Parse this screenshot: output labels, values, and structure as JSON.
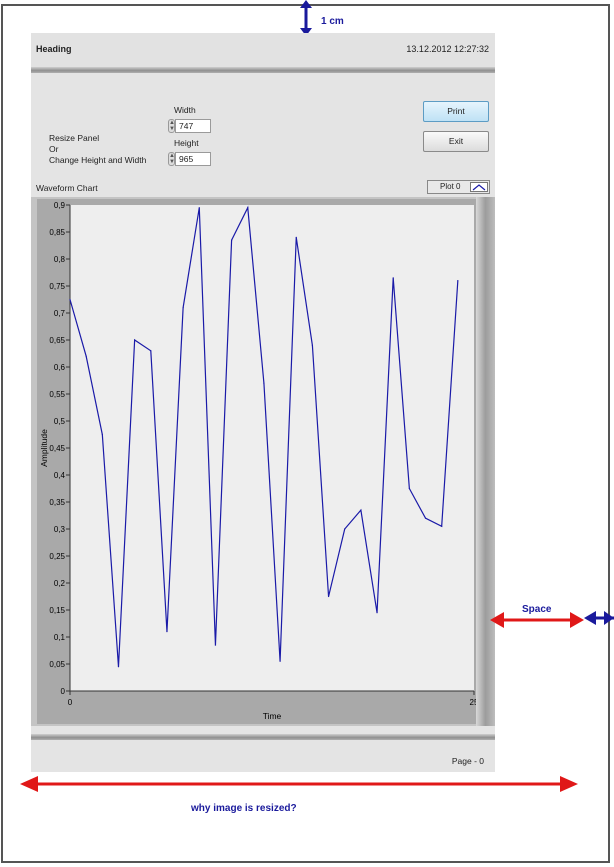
{
  "annotations": {
    "top_label": "1 cm",
    "side_label": "Space",
    "bottom_label": "why image is resized?"
  },
  "panel": {
    "heading": "Heading",
    "datetime": "13.12.2012 12:27:32",
    "resize_text": [
      "Resize Panel",
      "Or",
      "Change Height and Width"
    ],
    "width_label": "Width",
    "width_value": "747",
    "height_label": "Height",
    "height_value": "965",
    "print_label": "Print",
    "exit_label": "Exit",
    "chart_title": "Waveform Chart",
    "legend_label": "Plot 0",
    "page_label": "Page - 0"
  },
  "colors": {
    "plot_line": "#1a1aa8",
    "annotation_red": "#e01818",
    "annotation_blue": "#1a1a9c"
  },
  "chart_data": {
    "type": "line",
    "xlabel": "Time",
    "ylabel": "Amplitude",
    "xlim": [
      0,
      25
    ],
    "ylim": [
      0,
      0.9
    ],
    "x_ticks": [
      "0",
      "25"
    ],
    "y_ticks": [
      "0",
      "0,05",
      "0,1",
      "0,15",
      "0,2",
      "0,25",
      "0,3",
      "0,35",
      "0,4",
      "0,45",
      "0,5",
      "0,55",
      "0,6",
      "0,65",
      "0,7",
      "0,75",
      "0,8",
      "0,85",
      "0,9"
    ],
    "series": [
      {
        "name": "Plot 0",
        "x": [
          0,
          1,
          2,
          3,
          4,
          5,
          6,
          7,
          8,
          9,
          10,
          11,
          12,
          13,
          14,
          15,
          16,
          17,
          18,
          19,
          20,
          21,
          22,
          23,
          24
        ],
        "values": [
          0.725,
          0.62,
          0.475,
          0.045,
          0.65,
          0.63,
          0.11,
          0.71,
          0.895,
          0.085,
          0.835,
          0.895,
          0.57,
          0.055,
          0.84,
          0.64,
          0.175,
          0.3,
          0.335,
          0.145,
          0.765,
          0.375,
          0.32,
          0.305,
          0.76
        ]
      }
    ]
  }
}
